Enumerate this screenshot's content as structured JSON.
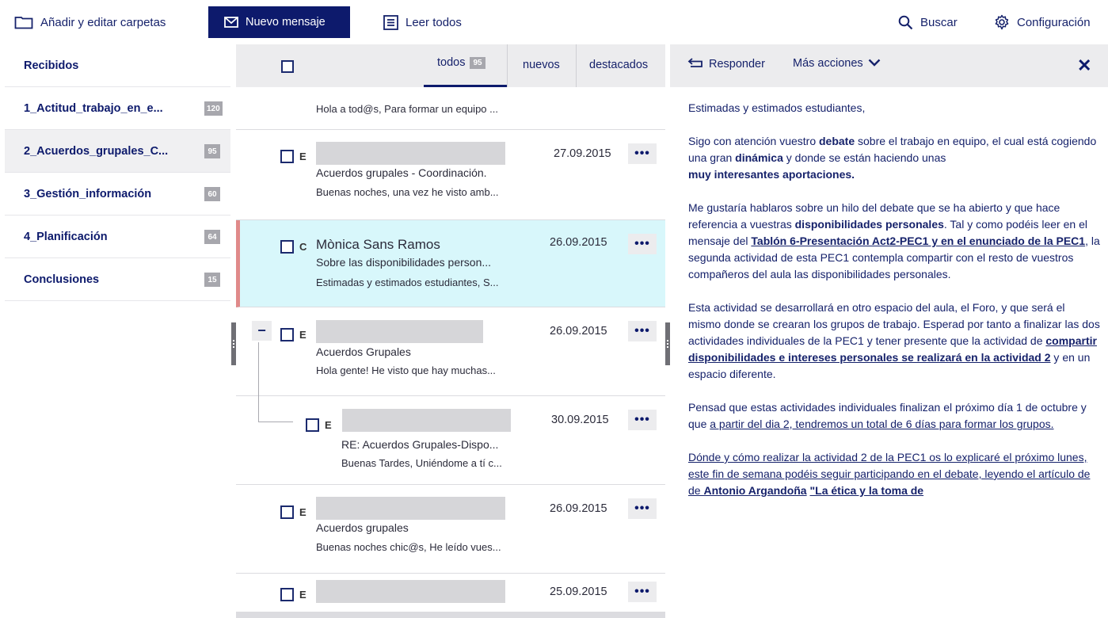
{
  "toolbar": {
    "folders_label": "Añadir y editar carpetas",
    "new_message_label": "Nuevo mensaje",
    "read_all_label": "Leer todos",
    "search_label": "Buscar",
    "settings_label": "Configuración"
  },
  "sidebar": {
    "items": [
      {
        "label": "Recibidos",
        "count": ""
      },
      {
        "label": "1_Actitud_trabajo_en_e...",
        "count": "120"
      },
      {
        "label": "2_Acuerdos_grupales_C...",
        "count": "95"
      },
      {
        "label": "3_Gestión_información",
        "count": "60"
      },
      {
        "label": "4_Planificación",
        "count": "64"
      },
      {
        "label": "Conclusiones",
        "count": "15"
      }
    ]
  },
  "list": {
    "tabs": {
      "all": "todos",
      "all_count": "95",
      "new": "nuevos",
      "starred": "destacados"
    },
    "messages": [
      {
        "letter": "",
        "sender": "",
        "date": "",
        "subject": "",
        "preview": "Hola a tod@s, Para formar un equipo ..."
      },
      {
        "letter": "E",
        "sender": "",
        "date": "27.09.2015",
        "subject": "Acuerdos grupales - Coordinación.",
        "preview": "Buenas noches, una vez he visto amb..."
      },
      {
        "letter": "C",
        "sender": "Mònica Sans Ramos",
        "date": "26.09.2015",
        "subject": "Sobre las disponibilidades person...",
        "preview": "Estimadas y estimados estudiantes, S..."
      },
      {
        "letter": "E",
        "sender": "",
        "date": "26.09.2015",
        "subject": "Acuerdos Grupales",
        "preview": "Hola gente! He visto que hay muchas..."
      },
      {
        "letter": "E",
        "sender": "",
        "date": "30.09.2015",
        "subject": "RE: Acuerdos Grupales-Dispo...",
        "preview": "Buenas Tardes, Uniéndome a tí c..."
      },
      {
        "letter": "E",
        "sender": "",
        "date": "26.09.2015",
        "subject": "Acuerdos grupales",
        "preview": "Buenas noches chic@s, He leído vues..."
      },
      {
        "letter": "E",
        "sender": "",
        "date": "25.09.2015",
        "subject": "",
        "preview": ""
      }
    ],
    "more_glyph": "•••",
    "thread_toggle": "−"
  },
  "reader": {
    "reply_label": "Responder",
    "more_actions_label": "Más acciones",
    "close_glyph": "✕",
    "greeting": "Estimadas y estimados estudiantes,",
    "p1": {
      "t1": "Sigo con atención vuestro ",
      "b1": "debate",
      "t2": " sobre el trabajo en equipo, el cual está cogiendo una gran ",
      "b2": "dinámica",
      "t3": " y donde se están haciendo unas ",
      "b3": "muy interesantes aportaciones."
    },
    "p2": {
      "t1": "Me gustaría hablaros sobre un hilo del debate que se ha abierto y que hace referencia a vuestras ",
      "b1": "disponibilidades personales",
      "t2": ". Tal y como podéis leer en el mensaje del ",
      "link": "Tablón 6-Presentación Act2-PEC1 y en el enunciado de la PEC1",
      "t3": ", la segunda actividad de esta PEC1 contempla compartir con el resto de vuestros compañeros del aula las disponibilidades personales."
    },
    "p3": {
      "t1": "Esta actividad se desarrollará en otro espacio del aula, el Foro, y que será el mismo donde se crearan los grupos de trabajo. Esperad por tanto a finalizar las dos actividades individuales de la PEC1 y tener presente que la actividad de ",
      "link": "compartir disponibilidades e intereses personales se realizará en la actividad 2",
      "t2": " y en un espacio diferente."
    },
    "p4": {
      "t1": "Pensad que estas actividades individuales finalizan el próximo día 1 de octubre y que ",
      "link": "a partir del dia 2, tendremos un total de 6 días para formar los grupos."
    },
    "p5": {
      "link1": "Dónde y cómo realizar la actividad 2 de la PEC1 os lo explicaré el próximo lunes, este fin de semana podéis seguir participando en el debate, leyendo el artículo de de ",
      "b1": "Antonio Argandoña",
      "t1": " ",
      "link2": "\"La ética y la toma de"
    }
  },
  "colors": {
    "primary": "#0d1a6c",
    "selected_row": "#d8f7fb",
    "selected_marker": "#e08a8a",
    "header_bg": "#ececee",
    "badge": "#a7a7ad"
  },
  "icons": [
    "folder-icon",
    "envelope-icon",
    "list-icon",
    "search-icon",
    "gear-icon",
    "reply-icon",
    "chevron-down-icon",
    "close-icon"
  ]
}
